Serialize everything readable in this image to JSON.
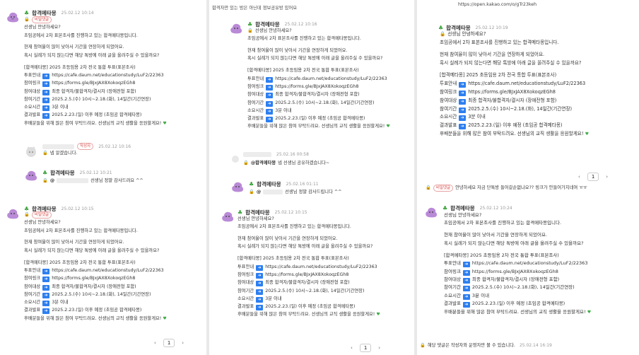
{
  "window": {
    "title": ""
  },
  "badges": {
    "secret": "비밀댓글",
    "author": "작성자"
  },
  "names": {
    "main": "합격메타몽"
  },
  "icons": {
    "leaf": "leaf-icon",
    "lock": "lock-icon",
    "arrow": "right-arrow-icon",
    "heart": "green-heart-icon",
    "avatar": "ditto-avatar-icon"
  },
  "announcement": {
    "greeting": "선생님 안녕하세요?",
    "intro": "초임공에서 2차 표본조사를 진행하고 있는 합격메타몽입니다.",
    "line1": "현재 참여율이 많이 낮아서 기간을 연장하게 되었어요.",
    "line2": "혹시 실례가 되지 않는다면 해당 톡방에 아래 글을 올려주실 수 있을까요?",
    "survey_title": "[합격메타몽] 2025 초등임용 2차 전국 통합 투표(표본조사)",
    "rows": [
      {
        "label": "투표안내",
        "value": "https://cafe.daum.net/educationstudy/LuF2/22363"
      },
      {
        "label": "참여링크",
        "value": "https://forms.gle/BJxJAX8XokoqzEGh8"
      },
      {
        "label": "참여대상",
        "value": "최종 합격자/불합격자/결시자 (장애전형 포함)"
      },
      {
        "label": "참여기간",
        "value": "2025.2.5.(수) 10시~2.18.(화), 14일간(기간연장)"
      },
      {
        "label": "소요시간",
        "value": "3분 이내"
      },
      {
        "label": "결과발표",
        "value": "2025.2.23.(일) 이후 예정 (초임공 합격메타몽)"
      }
    ],
    "closing": "후배분들을 위해 많은 참여 부탁드려요. 선생님의 교직 생활을 응원할게요!"
  },
  "panel1": {
    "c1_time": "25.02.12 10:14",
    "reply_badge": "작성자",
    "reply_time": "25.02.12 10:16",
    "reply_text": "넵 알겠습니다.",
    "c3_time": "25.02.12 10:21",
    "c3_mention": "@",
    "c3_text": "선생님 정말 감사드려요 ^^",
    "c4_time": "25.02.12 10:15",
    "page": "1"
  },
  "panel2": {
    "top_text": "합격자만 있는 방은 아닌데 정보공유방 있어요",
    "c1_time": "25.02.12 10:16",
    "reply_time": "25.02.16 00:58",
    "reply_mention": "@합격메타몽",
    "reply_text": "넵 선생님 공유하겠습니다~",
    "c3_time": "25.02.16 01:11",
    "c3_mention": "@",
    "c3_text": "선생님 정말 감사드립니다 ^^",
    "c4_time": "25.02.12 10:15",
    "page": "1"
  },
  "panel3": {
    "top_link": "https://open.kakao.com/o/gTr23keh",
    "c1_time": "25.02.12 10:19",
    "page": "1",
    "reply_badge": "비밀댓글",
    "reply_text": "안녕하세요 자금 단톡방 들어갈순없나요?? 링크가 안들어가지네여 ㅠㅠ",
    "c3_time": "25.02.12 10:24",
    "deleted_text": "해당 댓글은 작성자와 운영자만 볼 수 있습니다.",
    "deleted_time": "25.02.14 16:19"
  }
}
